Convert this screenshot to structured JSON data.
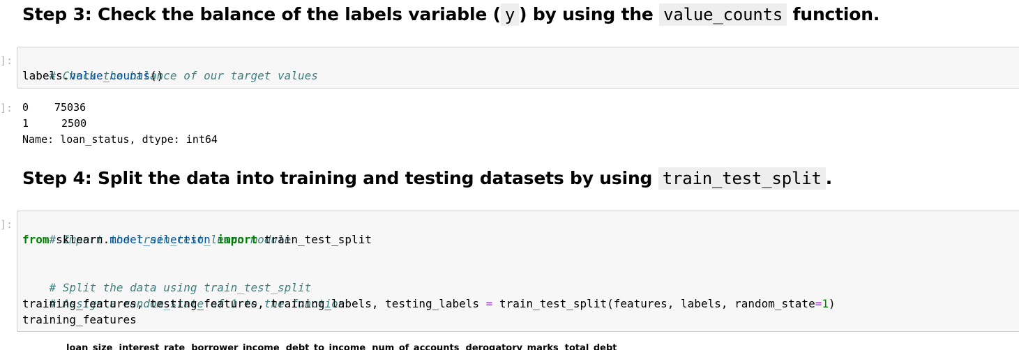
{
  "step3": {
    "prefix": "Step 3: Check the balance of the labels variable (",
    "code_y": "y",
    "middle": ") by using the ",
    "code_fn": "value_counts",
    "suffix": " function."
  },
  "cell1": {
    "prompt": "]:",
    "comment": "# Check the balance of our target values",
    "obj": "labels",
    "dot": ".",
    "method": "value_counts",
    "parens": "()"
  },
  "output1": {
    "prompt": "]:",
    "rows": [
      {
        "index": "0",
        "value": "75036"
      },
      {
        "index": "1",
        "value": "2500"
      }
    ],
    "footer": "Name: loan_status, dtype: int64"
  },
  "step4": {
    "prefix": "Step 4: Split the data into training and testing datasets by using ",
    "code_fn": "train_test_split",
    "suffix": "."
  },
  "cell2": {
    "prompt": "]:",
    "comment1": "# Import the train_test_learn module",
    "kw_from": "from",
    "module_a": "sklearn",
    "module_dot": ".",
    "module_b": "model_selection",
    "kw_import": "import",
    "import_name": "train_test_split",
    "comment2": "# Split the data using train_test_split",
    "comment3": "# Assign a random_state of 1 to the function",
    "assign_lhs": "training_features, testing_features, training_labels, testing_labels",
    "eq": "=",
    "call_pre": "train_test_split(features, labels, random_state",
    "call_eq": "=",
    "call_num": "1",
    "call_close": ")",
    "last_line": "training_features"
  },
  "partial_row": "loan_size  interest_rate  borrower_income  debt_to_income  num_of_accounts  derogatory_marks  total_debt"
}
